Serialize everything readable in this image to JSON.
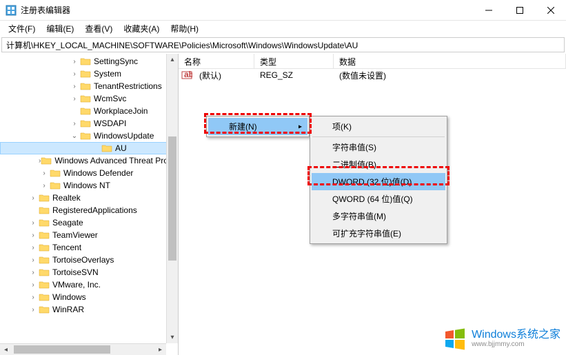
{
  "window": {
    "title": "注册表编辑器"
  },
  "menubar": {
    "file": "文件(F)",
    "edit": "编辑(E)",
    "view": "查看(V)",
    "favorites": "收藏夹(A)",
    "help": "帮助(H)"
  },
  "addressbar": {
    "path": "计算机\\HKEY_LOCAL_MACHINE\\SOFTWARE\\Policies\\Microsoft\\Windows\\WindowsUpdate\\AU"
  },
  "tree": {
    "items": [
      {
        "label": "SettingSync",
        "indent": 4,
        "toggle": ">"
      },
      {
        "label": "System",
        "indent": 4,
        "toggle": ">"
      },
      {
        "label": "TenantRestrictions",
        "indent": 4,
        "toggle": ">"
      },
      {
        "label": "WcmSvc",
        "indent": 4,
        "toggle": ">"
      },
      {
        "label": "WorkplaceJoin",
        "indent": 4,
        "toggle": ""
      },
      {
        "label": "WSDAPI",
        "indent": 4,
        "toggle": ">"
      },
      {
        "label": "WindowsUpdate",
        "indent": 4,
        "toggle": "v"
      },
      {
        "label": "AU",
        "indent": 5,
        "toggle": "",
        "selected": true
      },
      {
        "label": "Windows Advanced Threat Protection",
        "indent": 3,
        "toggle": ">"
      },
      {
        "label": "Windows Defender",
        "indent": 3,
        "toggle": ">"
      },
      {
        "label": "Windows NT",
        "indent": 3,
        "toggle": ">"
      },
      {
        "label": "Realtek",
        "indent": 2,
        "toggle": ">"
      },
      {
        "label": "RegisteredApplications",
        "indent": 2,
        "toggle": ""
      },
      {
        "label": "Seagate",
        "indent": 2,
        "toggle": ">"
      },
      {
        "label": "TeamViewer",
        "indent": 2,
        "toggle": ">"
      },
      {
        "label": "Tencent",
        "indent": 2,
        "toggle": ">"
      },
      {
        "label": "TortoiseOverlays",
        "indent": 2,
        "toggle": ">"
      },
      {
        "label": "TortoiseSVN",
        "indent": 2,
        "toggle": ">"
      },
      {
        "label": "VMware, Inc.",
        "indent": 2,
        "toggle": ">"
      },
      {
        "label": "Windows",
        "indent": 2,
        "toggle": ">"
      },
      {
        "label": "WinRAR",
        "indent": 2,
        "toggle": ">"
      }
    ]
  },
  "list": {
    "headers": {
      "name": "名称",
      "type": "类型",
      "data": "数据"
    },
    "rows": [
      {
        "name": "(默认)",
        "type": "REG_SZ",
        "data": "(数值未设置)"
      }
    ]
  },
  "context_menu": {
    "new_label": "新建(N)",
    "submenu": {
      "key": "项(K)",
      "string": "字符串值(S)",
      "binary": "二进制值(B)",
      "dword": "DWORD (32 位)值(D)",
      "qword": "QWORD (64 位)值(Q)",
      "multi": "多字符串值(M)",
      "expand": "可扩充字符串值(E)"
    }
  },
  "watermark": {
    "main": "Windows系统之家",
    "sub": "www.bjjmmy.com"
  }
}
